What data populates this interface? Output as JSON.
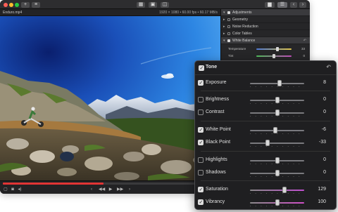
{
  "file": {
    "name": "Enduro.mp4",
    "info": "1920 × 1080 • 60.00 fps • 60.17 MB/s"
  },
  "sidebar": {
    "items": [
      {
        "label": "Adjustments",
        "checked": true,
        "selected": true
      },
      {
        "label": "Geometry",
        "checked": false
      },
      {
        "label": "Noise Reduction",
        "checked": false
      },
      {
        "label": "Color Tables",
        "checked": false
      },
      {
        "label": "White Balance",
        "checked": true,
        "selected": true
      }
    ],
    "params": [
      {
        "label": "Temperature",
        "value": "33",
        "level": 0.6
      },
      {
        "label": "Tint",
        "value": "0",
        "level": 0.5
      }
    ]
  },
  "panel": {
    "title": "Tone",
    "rows": [
      {
        "label": "Exposure",
        "value": "8",
        "checked": true,
        "level": 0.55
      },
      {
        "label": "Brightness",
        "value": "0",
        "checked": false,
        "level": 0.5
      },
      {
        "label": "Contrast",
        "value": "0",
        "checked": false,
        "level": 0.5
      },
      {
        "label": "White Point",
        "value": "-6",
        "checked": true,
        "level": 0.47
      },
      {
        "label": "Black Point",
        "value": "-33",
        "checked": true,
        "level": 0.33
      },
      {
        "label": "Highlights",
        "value": "0",
        "checked": false,
        "level": 0.5
      },
      {
        "label": "Shadows",
        "value": "0",
        "checked": false,
        "level": 0.5
      },
      {
        "label": "Saturation",
        "value": "129",
        "checked": true,
        "level": 0.64
      },
      {
        "label": "Vibrancy",
        "value": "100",
        "checked": true,
        "level": 0.5
      }
    ]
  },
  "playback": {
    "progress": 0.47
  },
  "colors": {
    "accent": "#e03434",
    "saturation_track": "#c04fd0",
    "sky": "#1b63c9"
  }
}
